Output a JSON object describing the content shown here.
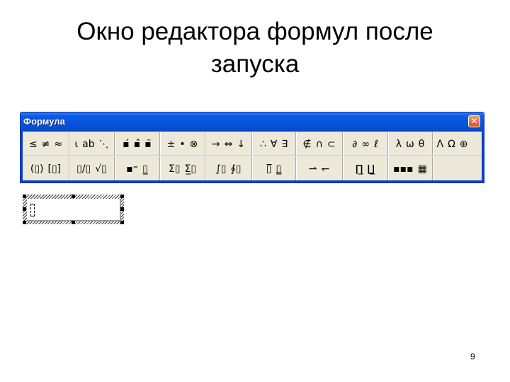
{
  "slide": {
    "title_lines": [
      "Окно редактора формул после",
      "запуска"
    ],
    "page_number": "9"
  },
  "window": {
    "title": "Формула",
    "close_glyph": "✕",
    "colors": {
      "titlebar": "#0a5ae6",
      "body": "#ece9d8",
      "close": "#d8511f"
    }
  },
  "toolbar": {
    "row1": [
      {
        "name": "relations",
        "symbols": [
          "≤",
          "≠",
          "≈"
        ]
      },
      {
        "name": "spaces-ellipses",
        "symbols": [
          "⍳",
          "ab",
          "⋱"
        ]
      },
      {
        "name": "embellishments",
        "symbols": [
          "▪́",
          "▪̂",
          "▪̈"
        ]
      },
      {
        "name": "operators",
        "symbols": [
          "±",
          "•",
          "⊗"
        ]
      },
      {
        "name": "arrows",
        "symbols": [
          "→",
          "⇔",
          "↓"
        ]
      },
      {
        "name": "logic",
        "symbols": [
          "∴",
          "∀",
          "∃"
        ]
      },
      {
        "name": "set-theory",
        "symbols": [
          "∉",
          "∩",
          "⊂"
        ]
      },
      {
        "name": "misc-symbols",
        "symbols": [
          "∂",
          "∞",
          "ℓ"
        ]
      },
      {
        "name": "greek-lowercase",
        "symbols": [
          "λ",
          "ω",
          "θ"
        ]
      },
      {
        "name": "greek-uppercase",
        "symbols": [
          "Λ",
          "Ω",
          "⊛"
        ]
      }
    ],
    "row2": [
      {
        "name": "fences",
        "symbols": [
          "(▯)",
          "[▯]"
        ]
      },
      {
        "name": "fractions-radicals",
        "symbols": [
          "▯/▯",
          "√▯"
        ]
      },
      {
        "name": "subscripts-superscripts",
        "symbols": [
          "▪⁼",
          "▯̲"
        ]
      },
      {
        "name": "summations",
        "symbols": [
          "Σ▯",
          "Σ̲▯"
        ]
      },
      {
        "name": "integrals",
        "symbols": [
          "∫▯",
          "∮▯"
        ]
      },
      {
        "name": "underbars-overbars",
        "symbols": [
          "▯̅",
          "▯̳"
        ]
      },
      {
        "name": "labeled-arrows",
        "symbols": [
          "⇀",
          "↽"
        ]
      },
      {
        "name": "products-set-theory",
        "symbols": [
          "∏̲",
          "∐̲"
        ]
      },
      {
        "name": "matrices",
        "symbols": [
          "▪▪▪",
          "▦"
        ]
      },
      {
        "name": "empty",
        "symbols": []
      }
    ]
  }
}
